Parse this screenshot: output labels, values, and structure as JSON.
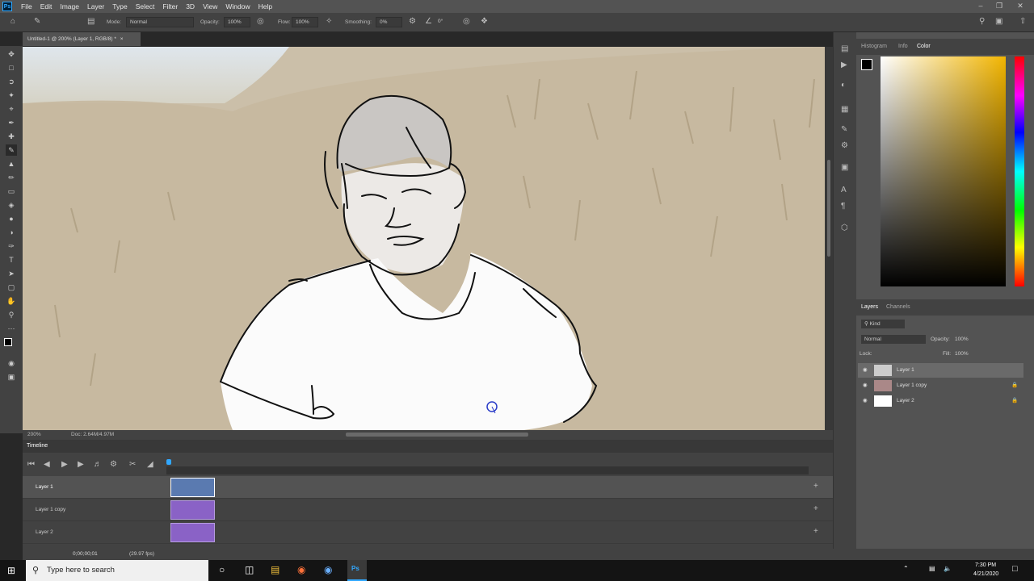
{
  "app": {
    "logo": "Ps"
  },
  "menu": [
    "File",
    "Edit",
    "Image",
    "Layer",
    "Type",
    "Select",
    "Filter",
    "3D",
    "View",
    "Window",
    "Help"
  ],
  "options": {
    "mode_label": "Mode:",
    "mode_value": "Normal",
    "opacity_label": "Opacity:",
    "opacity_value": "100%",
    "flow_label": "Flow:",
    "flow_value": "100%",
    "smoothing_label": "Smoothing:",
    "smoothing_value": "0%",
    "angle_value": "0°"
  },
  "document": {
    "tab_title": "Untitled-1 @ 200% (Layer 1, RGB/8) *",
    "zoom": "200%",
    "doc_info": "Doc: 2.64M/4.97M"
  },
  "panels": {
    "top_tabs": [
      "Histogram",
      "Info",
      "Color"
    ],
    "layers_tabs": [
      "Layers",
      "Channels"
    ],
    "kind_label": "Kind",
    "blend_mode": "Normal",
    "opacity_label": "Opacity:",
    "opacity_value": "100%",
    "lock_label": "Lock:",
    "fill_label": "Fill:",
    "fill_value": "100%",
    "layers": [
      "Layer 1",
      "Layer 1 copy",
      "Layer 2"
    ]
  },
  "timeline": {
    "title": "Timeline",
    "tracks": [
      "Layer 1",
      "Layer 1 copy",
      "Layer 2"
    ],
    "timecode": "0;00;00;01",
    "fps": "(29.97 fps)"
  },
  "taskbar": {
    "search_placeholder": "Type here to search",
    "time": "7:30 PM",
    "date": "4/21/2020"
  },
  "colors": {
    "accent": "#31a8ff",
    "clip_selected": "#5a7ab0",
    "clip": "#8a62c6"
  }
}
